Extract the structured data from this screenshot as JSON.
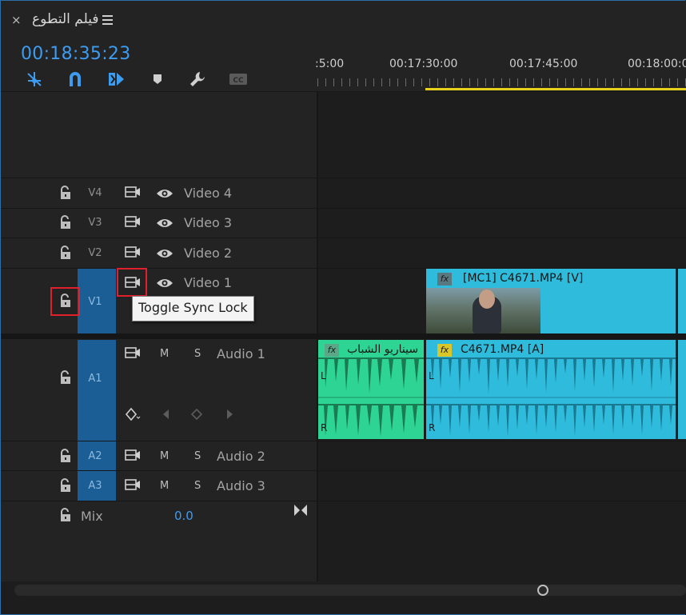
{
  "panel": {
    "close_glyph": "×",
    "sequence_title": "فيلم التطوع",
    "menu_icon": "hamburger-menu-icon",
    "timecode": "00:18:35:23"
  },
  "toolbar": {
    "tools": [
      {
        "name": "snap-icon"
      },
      {
        "name": "linked-selection-icon"
      },
      {
        "name": "insert-sequence-icon"
      },
      {
        "name": "add-marker-icon"
      },
      {
        "name": "timeline-settings-wrench-icon"
      },
      {
        "name": "captions-icon",
        "label": "CC"
      }
    ]
  },
  "ruler": {
    "labels": [
      ":5:00",
      "00:17:30:00",
      "00:17:45:00",
      "00:18:00:0"
    ]
  },
  "video_tracks": [
    {
      "id": "V4",
      "name": "Video 4"
    },
    {
      "id": "V3",
      "name": "Video 3"
    },
    {
      "id": "V2",
      "name": "Video 2"
    },
    {
      "id": "V1",
      "name": "Video 1"
    }
  ],
  "audio_tracks": [
    {
      "id": "A1",
      "name": "Audio 1",
      "mute": "M",
      "solo": "S"
    },
    {
      "id": "A2",
      "name": "Audio 2",
      "mute": "M",
      "solo": "S"
    },
    {
      "id": "A3",
      "name": "Audio 3",
      "mute": "M",
      "solo": "S"
    }
  ],
  "mix": {
    "label": "Mix",
    "value": "0.0"
  },
  "tooltip": {
    "text": "Toggle Sync Lock"
  },
  "clips": {
    "video_clip": {
      "fx": "fx",
      "name": "[MC1] C4671.MP4 [V]"
    },
    "audio_clip_green": {
      "fx": "fx",
      "name": "سيناريو الشباب",
      "left_channel": "L",
      "right_channel": "R"
    },
    "audio_clip_blue": {
      "fx": "fx",
      "name": "C4671.MP4 [A]",
      "left_channel": "L",
      "right_channel": "R"
    }
  },
  "colors": {
    "accent_blue": "#3d9cf0",
    "clip_cyan": "#2fbcdc",
    "clip_green": "#2ed494",
    "work_area": "#e8d11c",
    "highlight_red": "#e0212b"
  }
}
